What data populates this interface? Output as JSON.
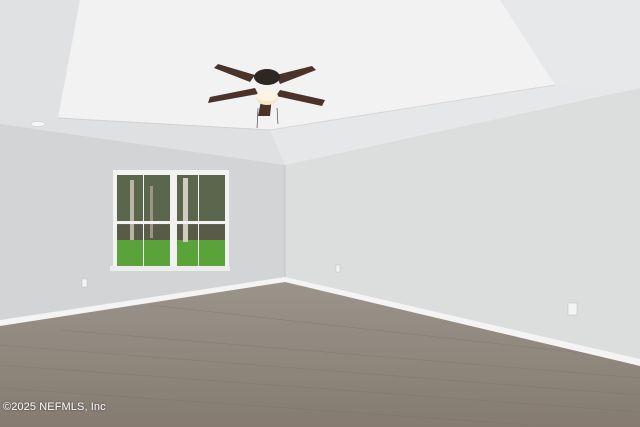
{
  "photo": {
    "watermark": "©2025 NEFMLS, Inc",
    "colors": {
      "wall_left": "#d3d4d5",
      "wall_right": "#dcdddd",
      "ceiling": "#e9eaeb",
      "floor": "#8d8479",
      "baseboard": "#f4f4f4",
      "fan_blade": "#4a3329",
      "grass": "#5aa23a",
      "foliage": "#3f4b33"
    }
  }
}
